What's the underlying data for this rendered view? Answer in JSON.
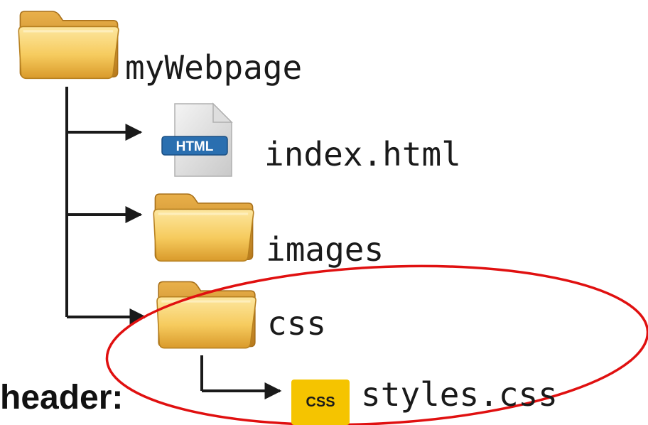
{
  "tree": {
    "root": {
      "label": "myWebpage",
      "icon": "folder-icon"
    },
    "children": [
      {
        "label": "index.html",
        "icon": "html-file-icon",
        "badge": "HTML"
      },
      {
        "label": "images",
        "icon": "folder-icon"
      },
      {
        "label": "css",
        "icon": "folder-icon",
        "children": [
          {
            "label": "styles.css",
            "icon": "css-file-icon",
            "badge": "CSS"
          }
        ]
      }
    ]
  },
  "caption": "header:",
  "highlight": {
    "shape": "ellipse",
    "color": "#e01010",
    "target": "css"
  },
  "colors": {
    "connector": "#1a1a1a",
    "folder": "#f3c45a",
    "css_badge": "#f5c400",
    "html_badge": "#2a6fb0"
  }
}
